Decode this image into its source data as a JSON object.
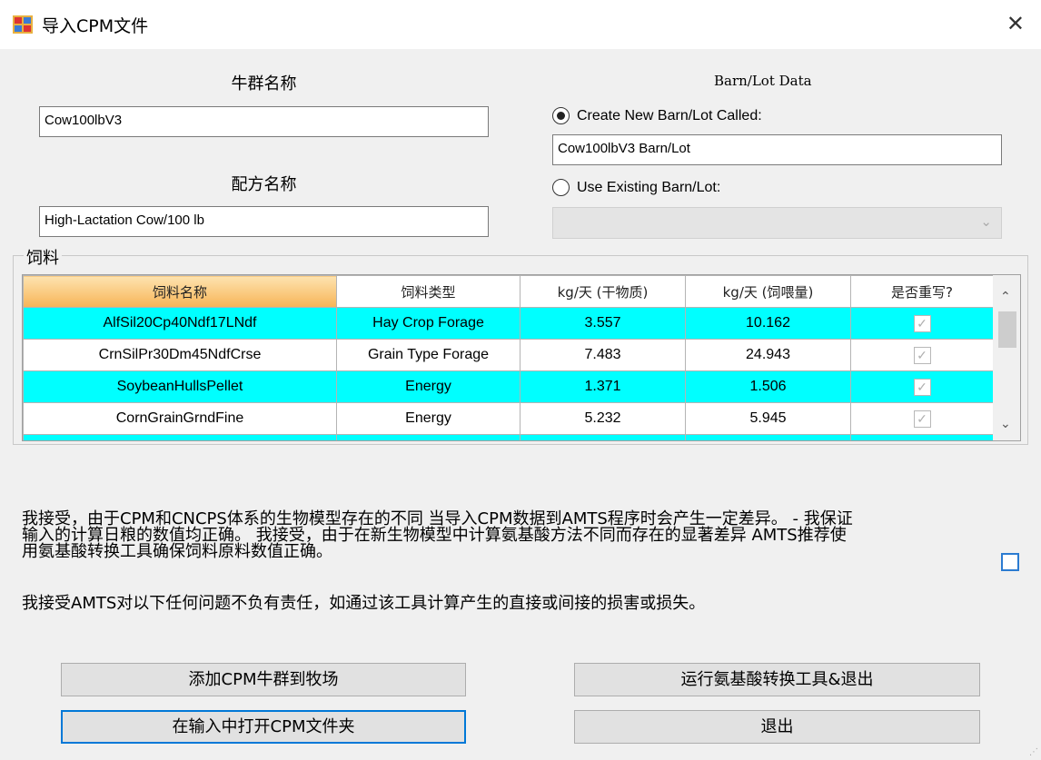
{
  "window": {
    "title": "导入CPM文件",
    "close_glyph": "✕"
  },
  "left": {
    "herd_label": "牛群名称",
    "herd_value": "Cow100lbV3",
    "ration_label": "配方名称",
    "ration_value": "High-Lactation Cow/100 lb"
  },
  "barn": {
    "header": "Barn/Lot Data",
    "create_label": "Create New Barn/Lot Called:",
    "create_value": "Cow100lbV3 Barn/Lot",
    "existing_label": "Use Existing Barn/Lot:",
    "selected": "create"
  },
  "feeds": {
    "group_label": "饲料",
    "columns": [
      "饲料名称",
      "饲料类型",
      "kg/天 (干物质)",
      "kg/天 (饲喂量)",
      "是否重写?"
    ],
    "rows": [
      {
        "name": "AlfSil20Cp40Ndf17LNdf",
        "type": "Hay Crop Forage",
        "dm": "3.557",
        "asfed": "10.162",
        "overwrite": true
      },
      {
        "name": "CrnSilPr30Dm45NdfCrse",
        "type": "Grain Type Forage",
        "dm": "7.483",
        "asfed": "24.943",
        "overwrite": true
      },
      {
        "name": "SoybeanHullsPellet",
        "type": "Energy",
        "dm": "1.371",
        "asfed": "1.506",
        "overwrite": true
      },
      {
        "name": "CornGrainGrndFine",
        "type": "Energy",
        "dm": "5.232",
        "asfed": "5.945",
        "overwrite": true
      }
    ]
  },
  "disclaimer": {
    "line1": "我接受，由于CPM和CNCPS体系的生物模型存在的不同 当导入CPM数据到AMTS程序时会产生一定差异。 - 我保证",
    "line2": "输入的计算日粮的数值均正确。 我接受，由于在新生物模型中计算氨基酸方法不同而存在的显著差异 AMTS推荐使",
    "line3": "用氨基酸转换工具确保饲料原料数值正确。",
    "line4": "我接受AMTS对以下任何问题不负有责任，如通过该工具计算产生的直接或间接的损害或损失。",
    "agreed": false
  },
  "buttons": {
    "add_herd": "添加CPM牛群到牧场",
    "run_tool": "运行氨基酸转换工具&退出",
    "open_folder": "在输入中打开CPM文件夹",
    "exit": "退出"
  },
  "colors": {
    "row_highlight": "#00ffff",
    "header_selected": "#f7b457",
    "focus_border": "#0078d7"
  }
}
